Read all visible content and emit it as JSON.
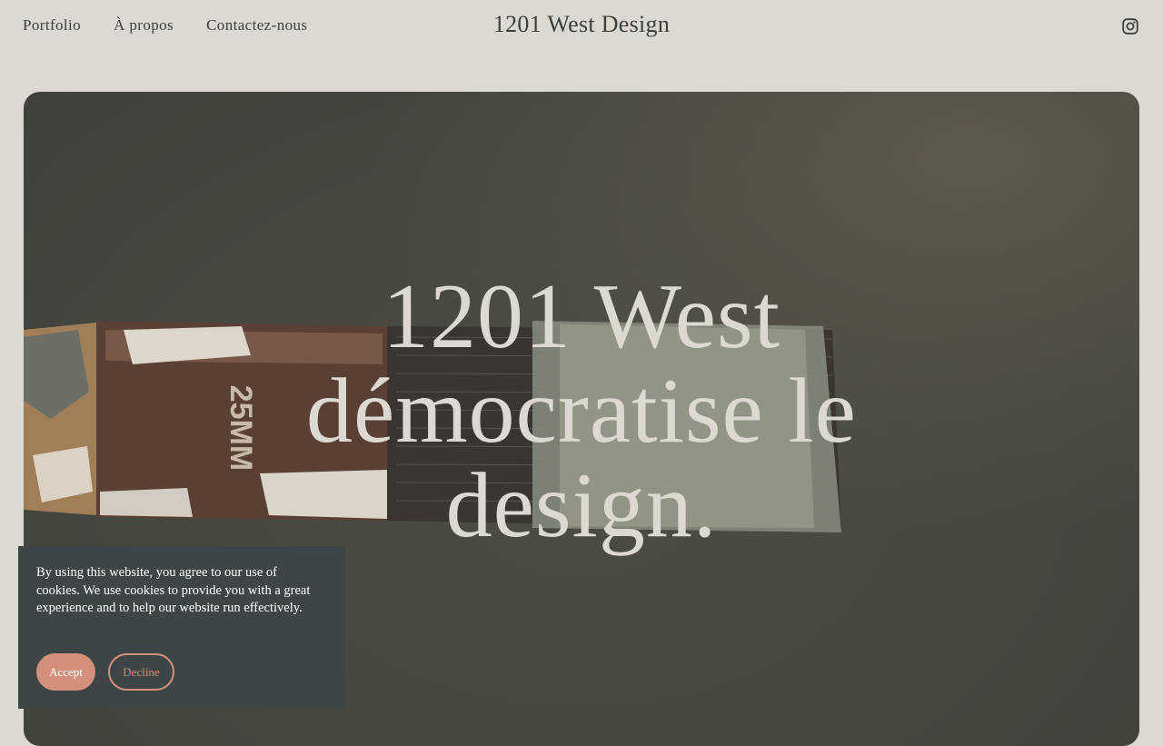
{
  "nav": {
    "items": [
      {
        "label": "Portfolio"
      },
      {
        "label": "À propos"
      },
      {
        "label": "Contactez-nous"
      }
    ]
  },
  "header": {
    "site_title": "1201 West Design",
    "social_icon": "instagram-icon"
  },
  "hero": {
    "headline_lines": [
      "1201 West",
      "démocratise le",
      "design."
    ],
    "image_icon": "paintbrush-image",
    "brush_label": "25MM"
  },
  "cookie_banner": {
    "message": "By using this website, you agree to our use of cookies. We use cookies to provide you with a great experience and to help our website run effectively.",
    "accept_label": "Accept",
    "decline_label": "Decline"
  },
  "colors": {
    "page_background": "#dcd9d2",
    "text_dark": "#3c3f3b",
    "hero_background": "#45473f",
    "cookie_background": "#3e4546",
    "accent": "#d4907a"
  }
}
